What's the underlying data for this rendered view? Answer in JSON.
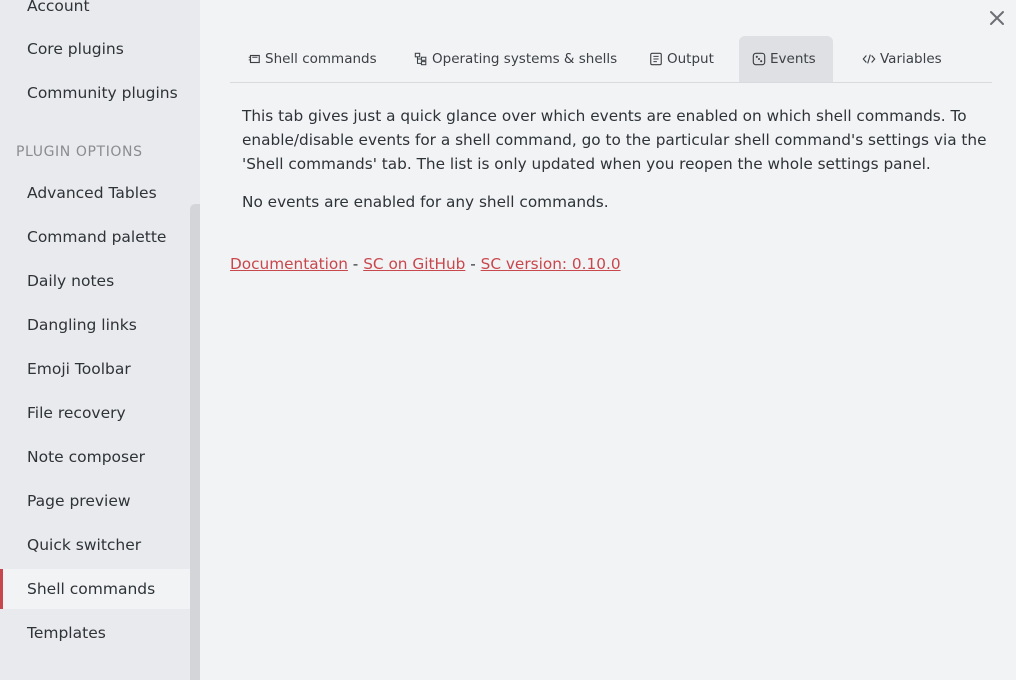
{
  "sidebar": {
    "items_top": [
      {
        "label": "Account"
      },
      {
        "label": "Core plugins"
      },
      {
        "label": "Community plugins"
      }
    ],
    "section_header": "PLUGIN OPTIONS",
    "plugin_items": [
      {
        "label": "Advanced Tables"
      },
      {
        "label": "Command palette"
      },
      {
        "label": "Daily notes"
      },
      {
        "label": "Dangling links"
      },
      {
        "label": "Emoji Toolbar"
      },
      {
        "label": "File recovery"
      },
      {
        "label": "Note composer"
      },
      {
        "label": "Page preview"
      },
      {
        "label": "Quick switcher"
      },
      {
        "label": "Shell commands",
        "active": true
      },
      {
        "label": "Templates"
      }
    ]
  },
  "tabs": [
    {
      "label": "Shell commands",
      "icon": "terminal-stack-icon"
    },
    {
      "label": "Operating systems & shells",
      "icon": "tree-icon"
    },
    {
      "label": "Output",
      "icon": "document-lines-icon"
    },
    {
      "label": "Events",
      "icon": "dice-icon",
      "active": true
    },
    {
      "label": "Variables",
      "icon": "code-brackets-icon"
    }
  ],
  "content": {
    "description": "This tab gives just a quick glance over which events are enabled on which shell commands. To enable/disable events for a shell command, go to the particular shell command's settings via the 'Shell commands' tab. The list is only updated when you reopen the whole settings panel.",
    "empty_message": "No events are enabled for any shell commands."
  },
  "footer": {
    "link_documentation": "Documentation",
    "separator": " - ",
    "link_github": "SC on GitHub",
    "link_version": "SC version: 0.10.0"
  },
  "colors": {
    "accent": "#c8474c",
    "background": "#f2f3f5",
    "sidebar": "#e9eaed"
  }
}
